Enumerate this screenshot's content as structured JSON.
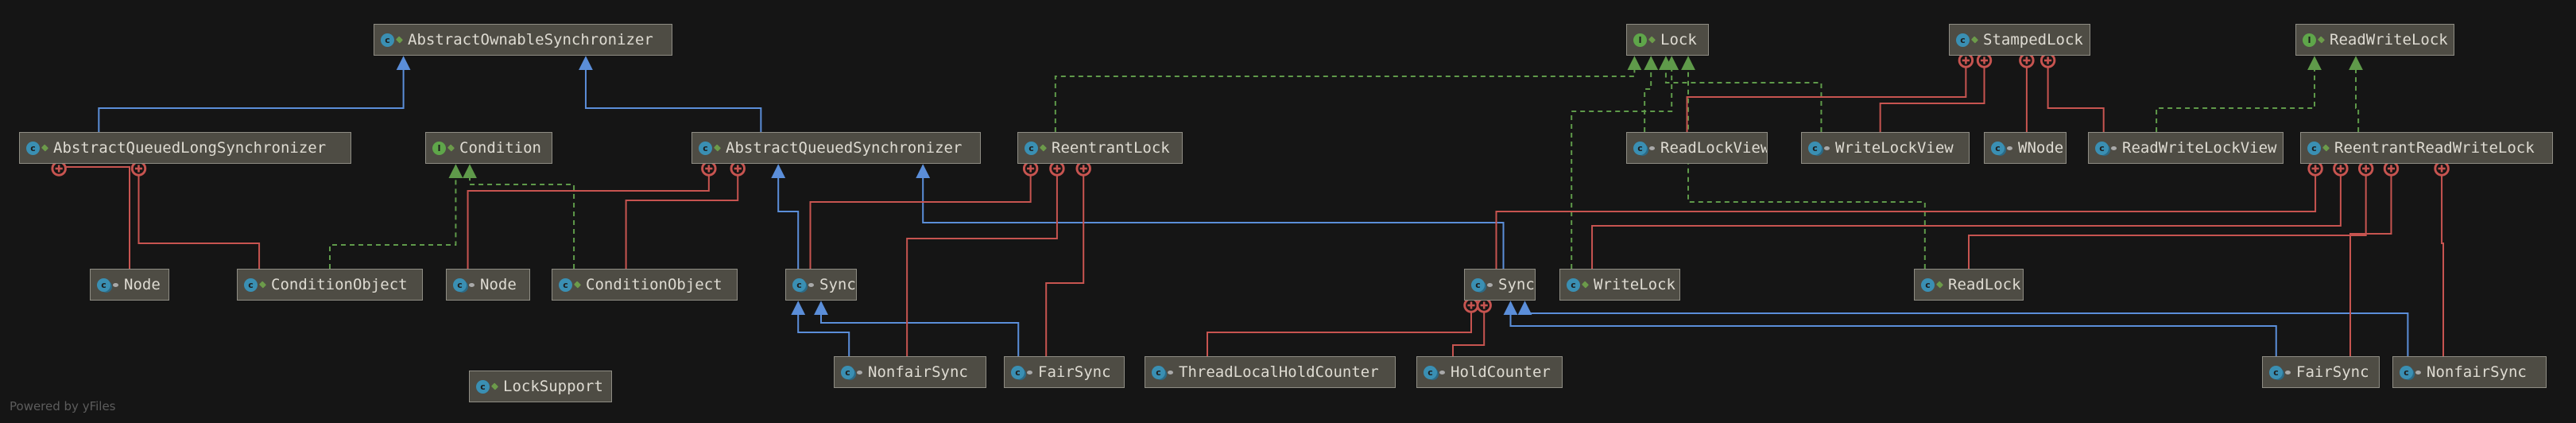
{
  "credit": "Powered by yFiles",
  "colors": {
    "background": "#151515",
    "node_fill": "#4e4c44",
    "node_border": "#8f8d84",
    "extends_edge": "#5b8ed9",
    "implements_edge": "#5f9a4a",
    "inner_class_edge": "#c75450"
  },
  "nodes": [
    {
      "id": "aos",
      "label": "AbstractOwnableSynchronizer",
      "kind": "class-icon",
      "visibility": "public-icon"
    },
    {
      "id": "aqls",
      "label": "AbstractQueuedLongSynchronizer",
      "kind": "class-icon",
      "visibility": "public-icon"
    },
    {
      "id": "cond",
      "label": "Condition",
      "kind": "interface-icon",
      "visibility": "public-icon"
    },
    {
      "id": "aqs",
      "label": "AbstractQueuedSynchronizer",
      "kind": "class-icon",
      "visibility": "public-icon"
    },
    {
      "id": "rl",
      "label": "ReentrantLock",
      "kind": "class-icon",
      "visibility": "public-icon"
    },
    {
      "id": "lock",
      "label": "Lock",
      "kind": "interface-icon",
      "visibility": "public-icon"
    },
    {
      "id": "sl",
      "label": "StampedLock",
      "kind": "class-icon",
      "visibility": "public-icon"
    },
    {
      "id": "rwl",
      "label": "ReadWriteLock",
      "kind": "interface-icon",
      "visibility": "public-icon"
    },
    {
      "id": "rlv",
      "label": "ReadLockView",
      "kind": "inner-class-icon",
      "visibility": "package-icon"
    },
    {
      "id": "wlv",
      "label": "WriteLockView",
      "kind": "inner-class-icon",
      "visibility": "package-icon"
    },
    {
      "id": "wn",
      "label": "WNode",
      "kind": "inner-class-icon",
      "visibility": "package-icon"
    },
    {
      "id": "rwlv",
      "label": "ReadWriteLockView",
      "kind": "inner-class-icon",
      "visibility": "package-icon"
    },
    {
      "id": "rrwl",
      "label": "ReentrantReadWriteLock",
      "kind": "class-icon",
      "visibility": "public-icon"
    },
    {
      "id": "node1",
      "label": "Node",
      "kind": "inner-class-icon",
      "visibility": "package-icon"
    },
    {
      "id": "co1",
      "label": "ConditionObject",
      "kind": "class-icon",
      "visibility": "public-icon"
    },
    {
      "id": "node2",
      "label": "Node",
      "kind": "inner-class-icon",
      "visibility": "package-icon"
    },
    {
      "id": "co2",
      "label": "ConditionObject",
      "kind": "class-icon",
      "visibility": "public-icon"
    },
    {
      "id": "sync1",
      "label": "Sync",
      "kind": "inner-class-icon",
      "visibility": "package-icon"
    },
    {
      "id": "sync2",
      "label": "Sync",
      "kind": "inner-class-icon",
      "visibility": "package-icon"
    },
    {
      "id": "wl",
      "label": "WriteLock",
      "kind": "class-icon",
      "visibility": "public-icon"
    },
    {
      "id": "rlk",
      "label": "ReadLock",
      "kind": "class-icon",
      "visibility": "public-icon"
    },
    {
      "id": "nfs1",
      "label": "NonfairSync",
      "kind": "inner-class-icon",
      "visibility": "package-icon"
    },
    {
      "id": "fs1",
      "label": "FairSync",
      "kind": "inner-class-icon",
      "visibility": "package-icon"
    },
    {
      "id": "tlhc",
      "label": "ThreadLocalHoldCounter",
      "kind": "inner-class-icon",
      "visibility": "package-icon"
    },
    {
      "id": "hc",
      "label": "HoldCounter",
      "kind": "inner-class-icon",
      "visibility": "package-icon"
    },
    {
      "id": "fs2",
      "label": "FairSync",
      "kind": "inner-class-icon",
      "visibility": "package-icon"
    },
    {
      "id": "nfs2",
      "label": "NonfairSync",
      "kind": "inner-class-icon",
      "visibility": "package-icon"
    },
    {
      "id": "ls",
      "label": "LockSupport",
      "kind": "class-icon",
      "visibility": "public-icon"
    }
  ],
  "edges": [
    {
      "from": "aqls",
      "to": "aos",
      "relation": "extends"
    },
    {
      "from": "aqs",
      "to": "aos",
      "relation": "extends"
    },
    {
      "from": "sync1",
      "to": "aqs",
      "relation": "extends"
    },
    {
      "from": "sync2",
      "to": "aqs",
      "relation": "extends"
    },
    {
      "from": "nfs1",
      "to": "sync1",
      "relation": "extends"
    },
    {
      "from": "fs1",
      "to": "sync1",
      "relation": "extends"
    },
    {
      "from": "fs2",
      "to": "sync2",
      "relation": "extends"
    },
    {
      "from": "nfs2",
      "to": "sync2",
      "relation": "extends"
    },
    {
      "from": "co1",
      "to": "cond",
      "relation": "implements"
    },
    {
      "from": "co2",
      "to": "cond",
      "relation": "implements"
    },
    {
      "from": "rl",
      "to": "lock",
      "relation": "implements"
    },
    {
      "from": "rlv",
      "to": "lock",
      "relation": "implements"
    },
    {
      "from": "wlv",
      "to": "lock",
      "relation": "implements"
    },
    {
      "from": "wl",
      "to": "lock",
      "relation": "implements"
    },
    {
      "from": "rlk",
      "to": "lock",
      "relation": "implements"
    },
    {
      "from": "rwlv",
      "to": "rwl",
      "relation": "implements"
    },
    {
      "from": "rrwl",
      "to": "rwl",
      "relation": "implements"
    },
    {
      "from": "node1",
      "to": "aqls",
      "relation": "inner"
    },
    {
      "from": "co1",
      "to": "aqls",
      "relation": "inner"
    },
    {
      "from": "node2",
      "to": "aqs",
      "relation": "inner"
    },
    {
      "from": "co2",
      "to": "aqs",
      "relation": "inner"
    },
    {
      "from": "sync1",
      "to": "rl",
      "relation": "inner"
    },
    {
      "from": "nfs1",
      "to": "rl",
      "relation": "inner"
    },
    {
      "from": "fs1",
      "to": "rl",
      "relation": "inner"
    },
    {
      "from": "rlv",
      "to": "sl",
      "relation": "inner"
    },
    {
      "from": "wlv",
      "to": "sl",
      "relation": "inner"
    },
    {
      "from": "wn",
      "to": "sl",
      "relation": "inner"
    },
    {
      "from": "rwlv",
      "to": "sl",
      "relation": "inner"
    },
    {
      "from": "sync2",
      "to": "rrwl",
      "relation": "inner"
    },
    {
      "from": "wl",
      "to": "rrwl",
      "relation": "inner"
    },
    {
      "from": "rlk",
      "to": "rrwl",
      "relation": "inner"
    },
    {
      "from": "fs2",
      "to": "rrwl",
      "relation": "inner"
    },
    {
      "from": "nfs2",
      "to": "rrwl",
      "relation": "inner"
    },
    {
      "from": "tlhc",
      "to": "sync2",
      "relation": "inner"
    },
    {
      "from": "hc",
      "to": "sync2",
      "relation": "inner"
    }
  ]
}
